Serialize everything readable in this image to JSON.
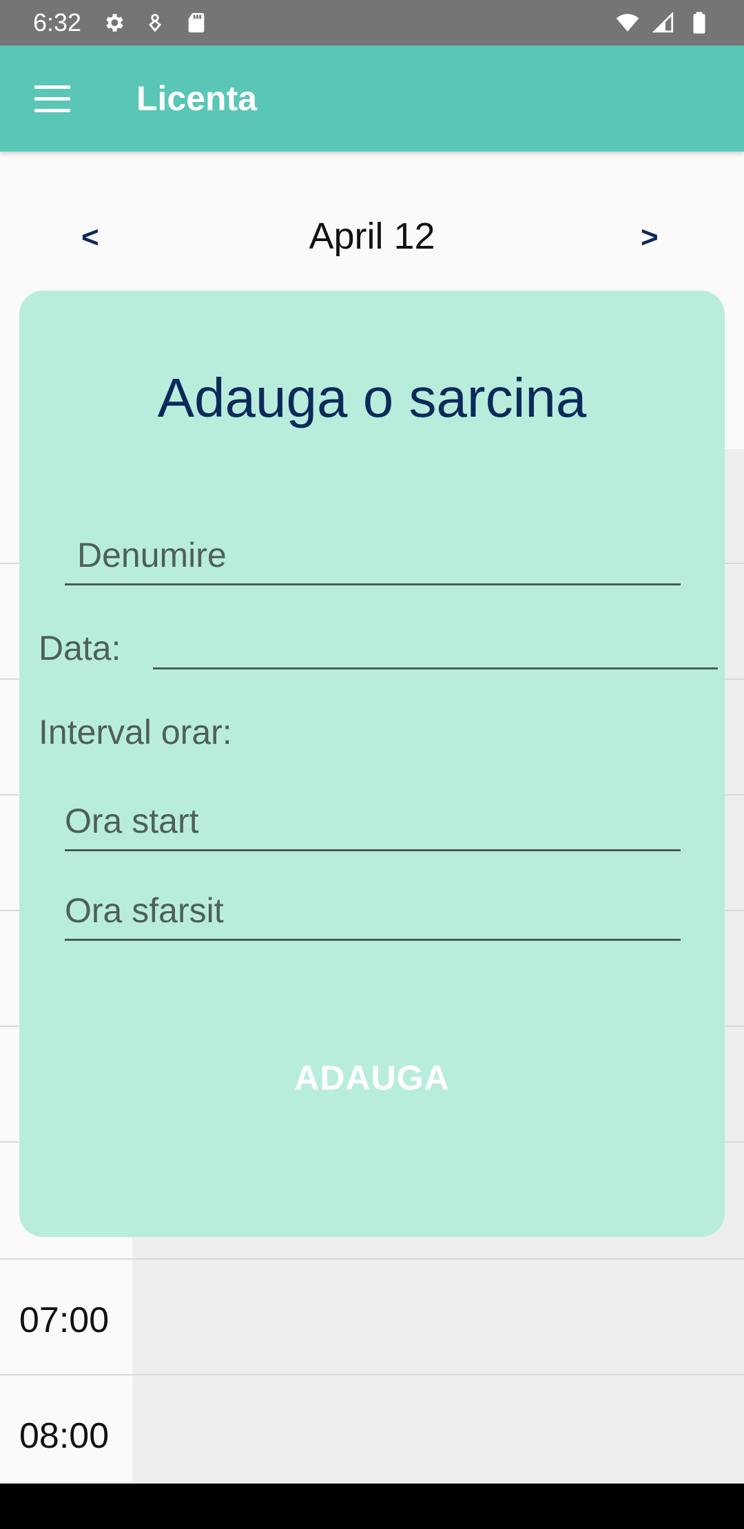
{
  "status_bar": {
    "time": "6:32",
    "icons_left": [
      "settings-icon",
      "notification-icon",
      "sd-card-icon"
    ],
    "icons_right": [
      "wifi-icon",
      "signal-icon",
      "battery-icon"
    ]
  },
  "app_bar": {
    "title": "Licenta",
    "menu_icon": "hamburger-menu-icon"
  },
  "date_nav": {
    "prev": "<",
    "date": "April 12",
    "next": ">"
  },
  "calendar": {
    "hours": [
      "",
      "",
      "",
      "",
      "",
      "",
      "07:00",
      "08:00"
    ]
  },
  "dialog": {
    "title": "Adauga o sarcina",
    "name_placeholder": "Denumire",
    "date_label": "Data:",
    "date_value": "",
    "interval_label": "Interval orar:",
    "start_placeholder": "Ora start",
    "end_placeholder": "Ora sfarsit",
    "add_button": "ADAUGA"
  },
  "colors": {
    "app_bar": "#59c6b6",
    "dialog_bg": "#b8eddc",
    "title_color": "#0b2a5a",
    "status_bar": "#757575"
  }
}
